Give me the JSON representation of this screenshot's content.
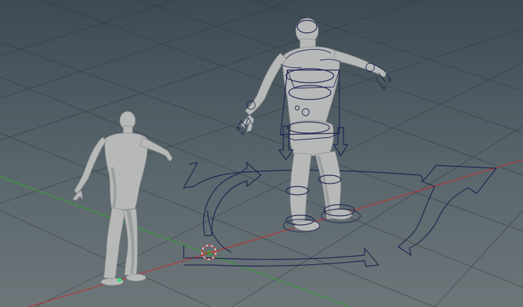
{
  "viewport": {
    "background": [
      "#3d4a53",
      "#6d7679"
    ],
    "grid_color": "#2f3840",
    "axis_x_color": "#b23a3a",
    "axis_z_color": "#3c9a3c",
    "rig_color": "#1f2350",
    "mesh_color": "#b7b9b9",
    "pivot_color": "#d94040",
    "selection_marker_color": "#33e07a"
  },
  "scene": {
    "objects": [
      {
        "name": "character-mesh-unrigged",
        "type": "mesh"
      },
      {
        "name": "character-mesh-rigged",
        "type": "mesh"
      },
      {
        "name": "rig-controls",
        "type": "curves"
      },
      {
        "name": "global-move-control",
        "type": "curve"
      },
      {
        "name": "world-pivot-manipulator",
        "type": "manipulator"
      }
    ]
  }
}
